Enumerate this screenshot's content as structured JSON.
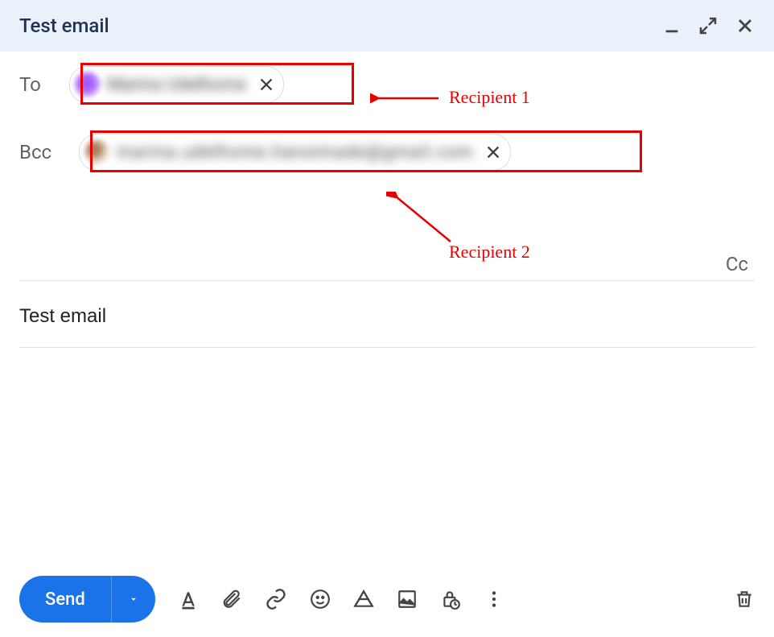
{
  "header": {
    "title": "Test email"
  },
  "recipients": {
    "to_label": "To",
    "bcc_label": "Bcc",
    "cc_label": "Cc",
    "to_chip_name": "Marina Udelhome",
    "bcc_chip_name": "marina.udelhome.hansimade@gmail.com"
  },
  "subject": {
    "value": "Test email"
  },
  "toolbar": {
    "send_label": "Send"
  },
  "annotations": {
    "recipient1": "Recipient 1",
    "recipient2": "Recipient 2"
  }
}
